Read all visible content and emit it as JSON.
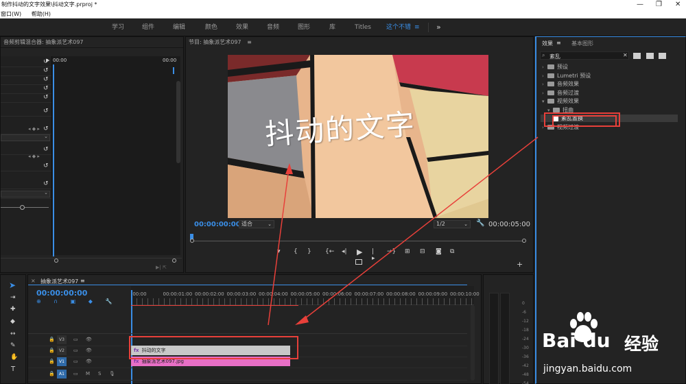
{
  "title_bar": {
    "title": "制作抖动的文字效果\\抖动文字.prproj *",
    "minimize": "—",
    "restore": "❐",
    "close": "✕"
  },
  "menu": {
    "items": [
      "窗口(W)",
      "帮助(H)"
    ]
  },
  "workspace": {
    "tabs": [
      "学习",
      "组件",
      "编辑",
      "颜色",
      "效果",
      "音频",
      "图形",
      "库",
      "Titles",
      "这个不错"
    ],
    "active_index": 9,
    "menu_icon": "≡",
    "overflow": "»"
  },
  "source_panel": {
    "title": "音频剪辑混合器: 抽象派艺术097",
    "tc_start": "00:00",
    "tc_end": "00:00"
  },
  "program_monitor": {
    "title": "节目: 抽象派艺术097",
    "menu_icon": "≡",
    "caption": "抖动的文字",
    "timecode": "00:00:00:00",
    "fit": "适合",
    "quality": "1/2",
    "duration": "00:00:05:00"
  },
  "effects_panel": {
    "tabs": [
      "效果",
      "基本图形"
    ],
    "menu_icon": "≡",
    "search_value": "紊乱",
    "clear": "✕",
    "tree": [
      {
        "label": "预设",
        "level": 0,
        "expanded": false
      },
      {
        "label": "Lumetri 预设",
        "level": 0,
        "expanded": false
      },
      {
        "label": "音频效果",
        "level": 0,
        "expanded": false
      },
      {
        "label": "音频过渡",
        "level": 0,
        "expanded": false
      },
      {
        "label": "视频效果",
        "level": 0,
        "expanded": true
      },
      {
        "label": "扭曲",
        "level": 1,
        "expanded": true
      },
      {
        "label": "紊乱置换",
        "level": 2,
        "expanded": false
      },
      {
        "label": "视频过渡",
        "level": 0,
        "expanded": false
      }
    ]
  },
  "timeline": {
    "title": "抽象派艺术097",
    "menu_icon": "≡",
    "timecode": "00:00:00:00",
    "ruler": [
      ":00:00",
      "00:00:01:00",
      "00:00:02:00",
      "00:00:03:00",
      "00:00:04:00",
      "00:00:05:00",
      "00:00:06:00",
      "00:00:07:00",
      "00:00:08:00",
      "00:00:09:00",
      "00:00:10:00"
    ],
    "tracks": [
      {
        "name": "V3"
      },
      {
        "name": "V2"
      },
      {
        "name": "V1"
      },
      {
        "name": "A1",
        "m": "M",
        "s": "S"
      }
    ],
    "clips": [
      {
        "label": "抖动的文字",
        "fx": "fx",
        "color": "#c8c8c8"
      },
      {
        "label": "抽象派艺术097.jpg",
        "fx": "fx",
        "color": "#e86fc6"
      }
    ]
  },
  "meters": {
    "scale": [
      "0",
      "-6",
      "-12",
      "-18",
      "-24",
      "-30",
      "-36",
      "-42",
      "-48",
      "-54"
    ]
  },
  "watermark": {
    "brand": "Bai du",
    "cn": "经验",
    "url": "jingyan.baidu.com"
  },
  "colors": {
    "accent": "#3a8ee6",
    "highlight": "#e8403a",
    "clip_title": "#c8c8c8",
    "clip_video": "#e86fc6"
  }
}
